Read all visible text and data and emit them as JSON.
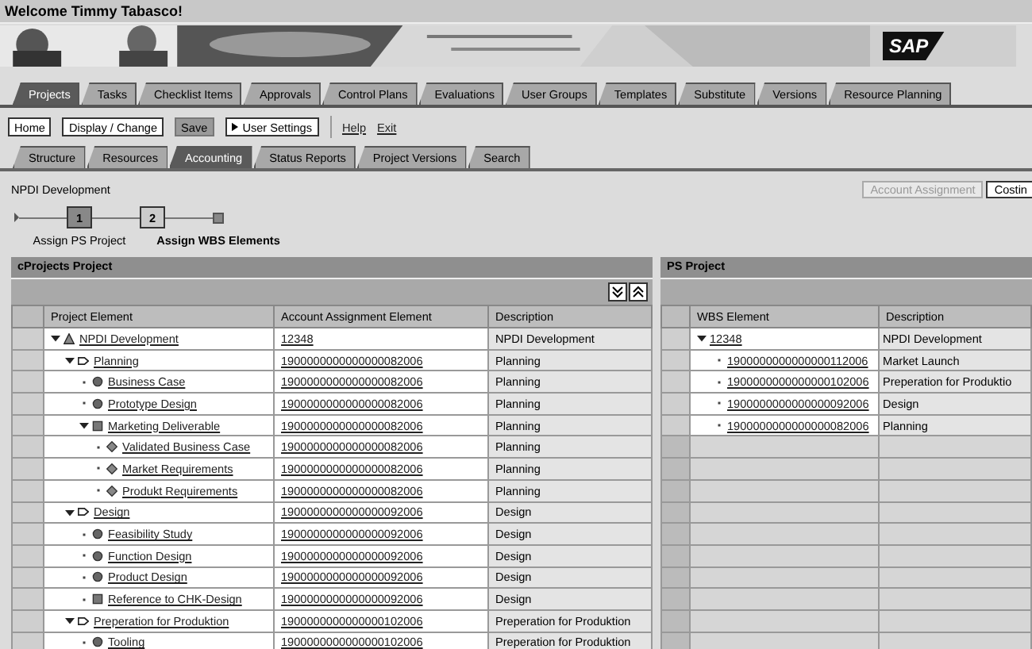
{
  "welcome": "Welcome Timmy Tabasco!",
  "logo": "SAP",
  "main_tabs": [
    {
      "label": "Projects",
      "selected": true
    },
    {
      "label": "Tasks",
      "selected": false
    },
    {
      "label": "Checklist Items",
      "selected": false
    },
    {
      "label": "Approvals",
      "selected": false
    },
    {
      "label": "Control Plans",
      "selected": false
    },
    {
      "label": "Evaluations",
      "selected": false
    },
    {
      "label": "User Groups",
      "selected": false
    },
    {
      "label": "Templates",
      "selected": false
    },
    {
      "label": "Substitute",
      "selected": false
    },
    {
      "label": "Versions",
      "selected": false
    },
    {
      "label": "Resource Planning",
      "selected": false
    }
  ],
  "toolbar_buttons": [
    {
      "label": "Home",
      "kind": "button",
      "pressed": false
    },
    {
      "label": "Display / Change",
      "kind": "button",
      "pressed": false
    },
    {
      "label": "Save",
      "kind": "button",
      "pressed": true
    },
    {
      "label": "User Settings",
      "kind": "menu",
      "pressed": false
    }
  ],
  "toolbar_links": [
    "Help",
    "Exit"
  ],
  "sub_tabs": [
    {
      "label": "Structure",
      "selected": false
    },
    {
      "label": "Resources",
      "selected": false
    },
    {
      "label": "Accounting",
      "selected": true
    },
    {
      "label": "Status Reports",
      "selected": false
    },
    {
      "label": "Project Versions",
      "selected": false
    },
    {
      "label": "Search",
      "selected": false
    }
  ],
  "project_name": "NPDI Development",
  "action_buttons": [
    {
      "label": "Account Assignment",
      "disabled": true
    },
    {
      "label": "Costin",
      "disabled": false
    }
  ],
  "roadmap": [
    {
      "number": "1",
      "label": "Assign PS Project",
      "selected": false
    },
    {
      "number": "2",
      "label": "Assign WBS Elements",
      "selected": true
    }
  ],
  "cprojects_panel": {
    "title": "cProjects Project",
    "columns": [
      "Project Element",
      "Account Assignment Element",
      "Description"
    ],
    "rows": [
      {
        "name": "NPDI Development",
        "kind": "project",
        "expanded": true,
        "account": "12348",
        "description": "NPDI Development",
        "children": [
          {
            "name": "Planning",
            "kind": "phase",
            "expanded": true,
            "account": "1900000000000000082006",
            "description": "Planning",
            "children": [
              {
                "name": "Business Case",
                "kind": "task",
                "account": "1900000000000000082006",
                "description": "Planning"
              },
              {
                "name": "Prototype Design",
                "kind": "task",
                "account": "1900000000000000082006",
                "description": "Planning"
              },
              {
                "name": "Marketing Deliverable",
                "kind": "deliverable",
                "expanded": true,
                "account": "1900000000000000082006",
                "description": "Planning",
                "children": [
                  {
                    "name": "Validated Business Case",
                    "kind": "checklist",
                    "account": "1900000000000000082006",
                    "description": "Planning"
                  },
                  {
                    "name": "Market Requirements",
                    "kind": "checklist",
                    "account": "1900000000000000082006",
                    "description": "Planning"
                  },
                  {
                    "name": "Produkt Requirements",
                    "kind": "checklist",
                    "account": "1900000000000000082006",
                    "description": "Planning"
                  }
                ]
              }
            ]
          },
          {
            "name": "Design",
            "kind": "phase",
            "expanded": true,
            "account": "1900000000000000092006",
            "description": "Design",
            "children": [
              {
                "name": "Feasibility Study",
                "kind": "task",
                "account": "1900000000000000092006",
                "description": "Design"
              },
              {
                "name": "Function Design",
                "kind": "task",
                "account": "1900000000000000092006",
                "description": "Design"
              },
              {
                "name": "Product Design",
                "kind": "task",
                "account": "1900000000000000092006",
                "description": "Design"
              },
              {
                "name": "Reference to CHK-Design",
                "kind": "deliverable",
                "account": "1900000000000000092006",
                "description": "Design"
              }
            ]
          },
          {
            "name": "Preperation for Produktion",
            "kind": "phase",
            "expanded": true,
            "account": "1900000000000000102006",
            "description": "Preperation for Produktion",
            "children": [
              {
                "name": "Tooling",
                "kind": "task",
                "account": "1900000000000000102006",
                "description": "Preperation for Produktion"
              }
            ]
          }
        ]
      }
    ]
  },
  "ps_panel": {
    "title": "PS Project",
    "columns": [
      "WBS Element",
      "Description"
    ],
    "rows": [
      {
        "wbs": "12348",
        "expanded": true,
        "description": "NPDI Development",
        "children": [
          {
            "wbs": "1900000000000000112006",
            "description": "Market Launch"
          },
          {
            "wbs": "1900000000000000102006",
            "description": "Preperation for Produktio"
          },
          {
            "wbs": "1900000000000000092006",
            "description": "Design"
          },
          {
            "wbs": "1900000000000000082006",
            "description": "Planning"
          }
        ]
      }
    ]
  }
}
